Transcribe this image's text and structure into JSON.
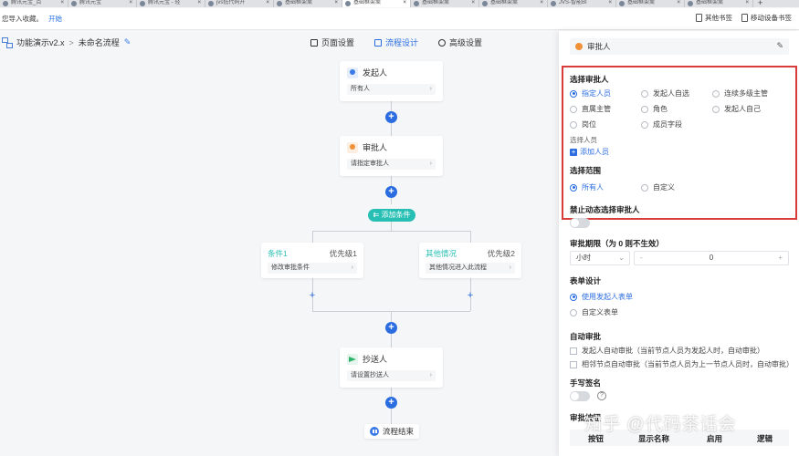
{
  "browser": {
    "tabs": [
      "腾讯元宝_百",
      "腾讯元宝",
      "腾讯元宝 - 轻",
      "jvs低代码开",
      "基础框架案",
      "基础框架案",
      "基础框架案",
      "基础框架案",
      "JVS-智能BI",
      "基础框架案",
      "基础框架案"
    ],
    "bookmark_tip": "您导入收藏。",
    "bookmark_link": "开始",
    "other_bookmarks": "其他书签",
    "mobile_bookmarks": "移动设备书签"
  },
  "header": {
    "app_name": "功能演示v2.x",
    "flow_name": "未命名流程",
    "tabs": [
      "页面设置",
      "流程设计",
      "高级设置"
    ]
  },
  "flow": {
    "start": {
      "title": "发起人",
      "field": "所有人"
    },
    "approver": {
      "title": "审批人",
      "field": "请指定审批人"
    },
    "add_condition": "添加条件",
    "branch1": {
      "title": "条件1",
      "priority": "优先级1",
      "field": "修改审批条件"
    },
    "branch2": {
      "title": "其他情况",
      "priority": "优先级2",
      "field": "其他情况进入此流程"
    },
    "cc": {
      "title": "抄送人",
      "field": "请设置抄送人"
    },
    "end": "流程结束"
  },
  "panel": {
    "title": "审批人",
    "select_approver": "选择审批人",
    "approver_options": [
      "指定人员",
      "发起人自选",
      "连续多级主管",
      "直属主管",
      "角色",
      "发起人自己",
      "岗位",
      "成员字段"
    ],
    "select_person_label": "选择人员",
    "add_person": "添加人员",
    "scope_label": "选择范围",
    "scope_options": [
      "所有人",
      "自定义"
    ],
    "forbid_dynamic": "禁止动态选择审批人",
    "deadline_label": "审批期限（为 0 则不生效）",
    "deadline_unit": "小时",
    "deadline_minus": "-",
    "deadline_value": "0",
    "deadline_plus": "+",
    "form_design": "表单设计",
    "form_options": [
      "使用发起人表单",
      "自定义表单"
    ],
    "auto_approve": "自动审批",
    "auto_options": [
      "发起人自动审批（当前节点人员为发起人时，自动审批）",
      "相邻节点自动审批（当前节点人员为上一节点人员时，自动审批）"
    ],
    "signature": "手写签名",
    "approval_buttons": "审批按钮",
    "table_headers": [
      "按钮",
      "显示名称",
      "启用",
      "逻辑"
    ]
  },
  "watermark": "知乎 @代码茶话会",
  "colors": {
    "primary": "#2b6de0",
    "teal": "#27bfb3",
    "highlight": "#d93a3a",
    "orange": "#f0913a",
    "green": "#2fb36b"
  }
}
